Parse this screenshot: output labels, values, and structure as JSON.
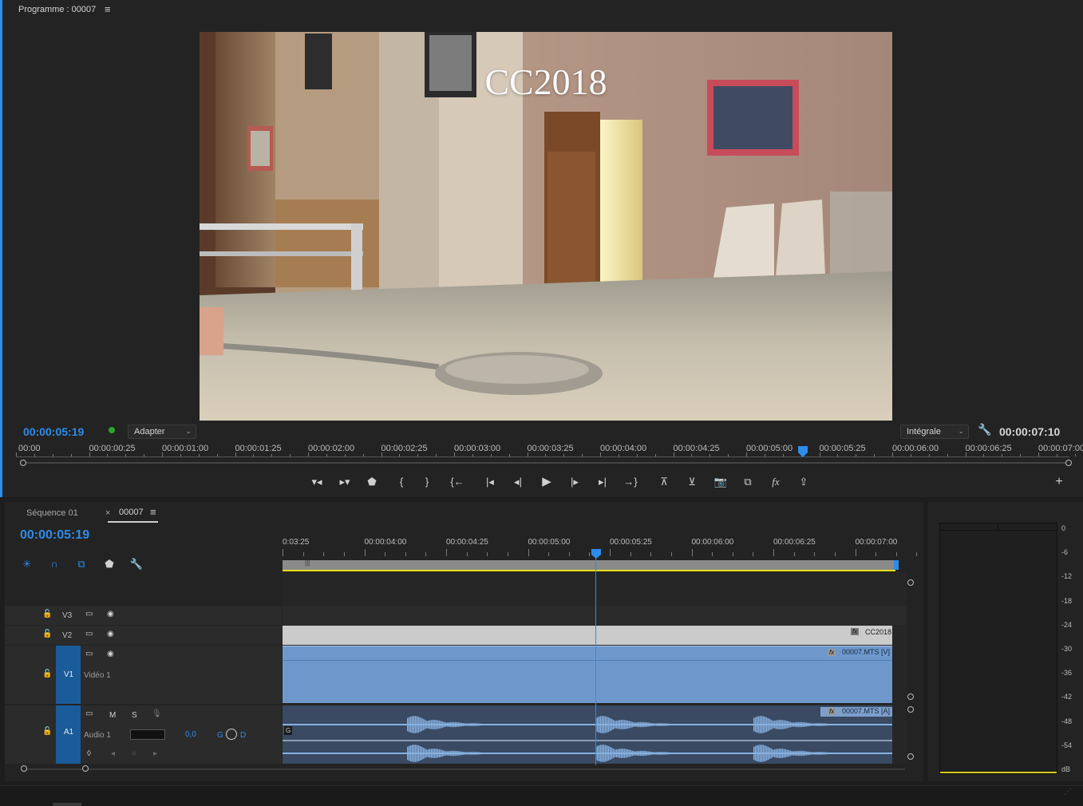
{
  "program_monitor": {
    "title": "Programme : 00007",
    "menu_icon": "hamburger-menu-icon",
    "overlay_title": "CC2018",
    "playhead_timecode": "00:00:05:19",
    "fit_dropdown": "Adapter",
    "quality_dropdown": "Intégrale",
    "duration_timecode": "00:00:07:10",
    "status_dot_color": "#2aa62a",
    "ruler_ticks": [
      "00:00",
      "00:00:00:25",
      "00:00:01:00",
      "00:00:01:25",
      "00:00:02:00",
      "00:00:02:25",
      "00:00:03:00",
      "00:00:03:25",
      "00:00:04:00",
      "00:00:04:25",
      "00:00:05:00",
      "00:00:05:25",
      "00:00:06:00",
      "00:00:06:25",
      "00:00:07:00"
    ],
    "transport_buttons": [
      "mark-in-icon",
      "mark-out-icon",
      "add-marker-icon",
      "mark-in-bracket-icon",
      "mark-out-bracket-icon",
      "go-to-in-icon",
      "go-to-previous-edit-icon",
      "step-back-icon",
      "play-icon",
      "step-forward-icon",
      "go-to-next-edit-icon",
      "go-to-out-icon",
      "lift-icon",
      "extract-icon",
      "export-frame-icon",
      "comparison-view-icon",
      "fx-icon",
      "export-icon",
      "add-button-icon"
    ]
  },
  "timeline": {
    "tabs": [
      {
        "label": "Séquence 01"
      },
      {
        "label": "00007",
        "close": "×"
      }
    ],
    "playhead_timecode": "00:00:05:19",
    "ruler_ticks": [
      "0:03:25",
      "00:00:04:00",
      "00:00:04:25",
      "00:00:05:00",
      "00:00:05:25",
      "00:00:06:00",
      "00:00:06:25",
      "00:00:07:00"
    ],
    "tools": [
      "insert-nest-icon",
      "snap-magnet-icon",
      "linked-selection-icon",
      "add-marker-icon",
      "wrench-settings-icon"
    ],
    "tracks": {
      "v3": {
        "label": "V3"
      },
      "v2": {
        "label": "V2"
      },
      "v1": {
        "label": "V1",
        "name": "Vidéo 1"
      },
      "a1": {
        "label": "A1",
        "name": "Audio 1",
        "volume": "0,0",
        "m": "M",
        "s": "S",
        "g": "G",
        "d": "D"
      }
    },
    "clips": {
      "title_clip": "CC2018",
      "video_clip": "00007.MTS [V]",
      "audio_clip": "00007.MTS [A]",
      "fx_badge": "fx",
      "g_badge": "G"
    },
    "colors": {
      "accent": "#2d8ceb",
      "video_clip": "#6e98cc",
      "audio_clip": "#394a62",
      "waveform": "#86b0e0",
      "title_clip": "#cbcbcb",
      "work_area": "#e6df1a"
    }
  },
  "audio_meter": {
    "db_labels": [
      "0",
      "-6",
      "-12",
      "-18",
      "-24",
      "-30",
      "-36",
      "-42",
      "-48",
      "-54",
      "dB"
    ]
  }
}
